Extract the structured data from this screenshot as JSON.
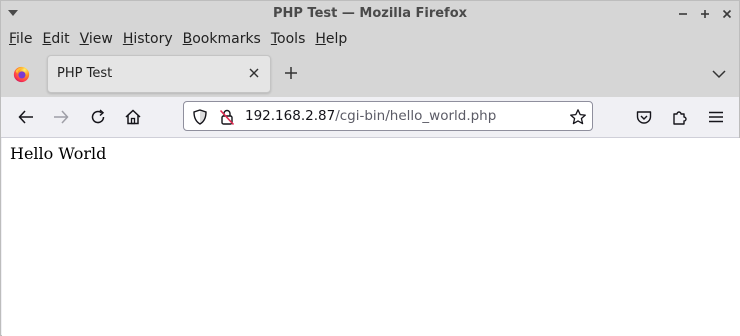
{
  "window": {
    "title": "PHP Test — Mozilla Firefox"
  },
  "menubar": {
    "items": [
      {
        "label": "File",
        "accel": "F",
        "rest": "ile"
      },
      {
        "label": "Edit",
        "accel": "E",
        "rest": "dit"
      },
      {
        "label": "View",
        "accel": "V",
        "rest": "iew"
      },
      {
        "label": "History",
        "accel": "H",
        "rest": "istory"
      },
      {
        "label": "Bookmarks",
        "accel": "B",
        "rest": "ookmarks"
      },
      {
        "label": "Tools",
        "accel": "T",
        "rest": "ools"
      },
      {
        "label": "Help",
        "accel": "H",
        "rest": "elp"
      }
    ]
  },
  "tabs": [
    {
      "label": "PHP Test",
      "active": true
    }
  ],
  "navbar": {
    "url_host": "192.168.2.87",
    "url_path": "/cgi-bin/hello_world.php"
  },
  "page": {
    "text": "Hello World"
  },
  "icons": {
    "app": "firefox-logo-icon",
    "back": "back-arrow-icon",
    "forward": "forward-arrow-icon",
    "reload": "reload-icon",
    "home": "home-icon",
    "tracking": "shield-icon",
    "insecure": "insecure-lock-icon",
    "bookmark": "star-icon",
    "pocket": "pocket-icon",
    "extensions": "extensions-icon",
    "menu": "hamburger-menu-icon"
  },
  "colors": {
    "chrome": "#d6d6d6",
    "toolbar": "#f0f0f4",
    "content": "#ffffff",
    "insecure_red": "#e22850"
  }
}
